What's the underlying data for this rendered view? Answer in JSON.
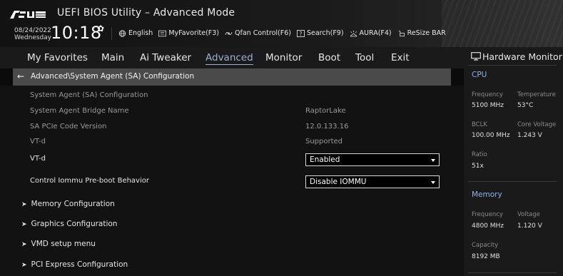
{
  "header": {
    "brand": "ASUS",
    "title": "UEFI BIOS Utility – Advanced Mode",
    "date": "08/24/2022",
    "weekday": "Wednesday",
    "time": "10:18",
    "menu": [
      {
        "label": "English",
        "icon": "globe-icon"
      },
      {
        "label": "MyFavorite(F3)",
        "icon": "favorite-icon"
      },
      {
        "label": "Qfan Control(F6)",
        "icon": "fan-icon"
      },
      {
        "label": "Search(F9)",
        "icon": "search-icon"
      },
      {
        "label": "AURA(F4)",
        "icon": "aura-icon"
      },
      {
        "label": "ReSize BAR",
        "icon": "resize-bar-icon"
      }
    ]
  },
  "tabs": [
    "My Favorites",
    "Main",
    "Ai Tweaker",
    "Advanced",
    "Monitor",
    "Boot",
    "Tool",
    "Exit"
  ],
  "active_tab": "Advanced",
  "breadcrumb": "Advanced\\System Agent (SA) Configuration",
  "main": {
    "section_heading": "System Agent (SA) Configuration",
    "info": [
      {
        "label": "System Agent Bridge Name",
        "value": "RaptorLake"
      },
      {
        "label": "SA PCIe Code Version",
        "value": "12.0.133.16"
      },
      {
        "label": "VT-d",
        "value": "Supported"
      }
    ],
    "settings": [
      {
        "label": "VT-d",
        "value": "Enabled"
      },
      {
        "label": "Control Iommu Pre-boot Behavior",
        "value": "Disable IOMMU"
      }
    ],
    "submenus": [
      "Memory Configuration",
      "Graphics Configuration",
      "VMD setup menu",
      "PCI Express Configuration"
    ]
  },
  "hardware_monitor": {
    "title": "Hardware Monitor",
    "cpu": {
      "heading": "CPU",
      "frequency_label": "Frequency",
      "frequency": "5100 MHz",
      "temperature_label": "Temperature",
      "temperature": "53°C",
      "bclk_label": "BCLK",
      "bclk": "100.00 MHz",
      "core_voltage_label": "Core Voltage",
      "core_voltage": "1.243 V",
      "ratio_label": "Ratio",
      "ratio": "51x"
    },
    "memory": {
      "heading": "Memory",
      "frequency_label": "Frequency",
      "frequency": "4800 MHz",
      "voltage_label": "Voltage",
      "voltage": "1.120 V",
      "capacity_label": "Capacity",
      "capacity": "8192 MB"
    }
  },
  "colors": {
    "accent": "#9db0d4",
    "monitor_heading": "#8fb2e6",
    "breadcrumb_bg": "#4a4a4a"
  }
}
